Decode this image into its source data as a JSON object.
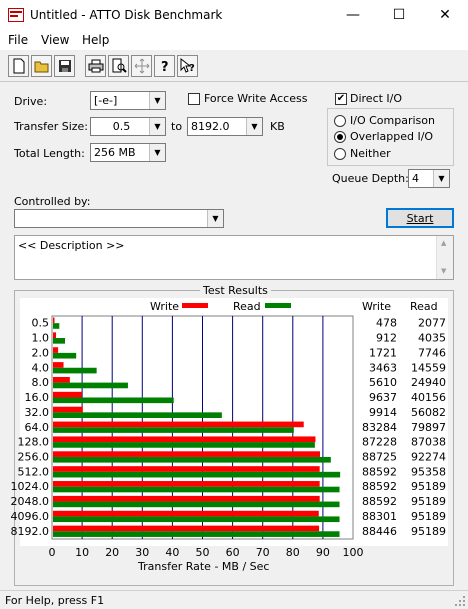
{
  "window": {
    "title": "Untitled - ATTO Disk Benchmark",
    "minimize_glyph": "—",
    "maximize_glyph": "☐",
    "close_glyph": "✕"
  },
  "menu": {
    "items": [
      "File",
      "View",
      "Help"
    ]
  },
  "toolbar": {
    "icons": [
      "new-document-icon",
      "open-folder-icon",
      "save-icon",
      "print-icon",
      "print-preview-icon",
      "move-icon",
      "help-icon",
      "context-help-icon"
    ]
  },
  "settings": {
    "drive_label": "Drive:",
    "drive_value": "[-e-]",
    "force_write_label": "Force Write Access",
    "force_write_checked": false,
    "direct_io_label": "Direct I/O",
    "direct_io_checked": true,
    "transfer_size_label": "Transfer Size:",
    "transfer_from": "0.5",
    "transfer_to_label": "to",
    "transfer_to": "8192.0",
    "transfer_unit": "KB",
    "total_length_label": "Total Length:",
    "total_length": "256 MB",
    "io_comparison_label": "I/O Comparison",
    "overlapped_io_label": "Overlapped I/O",
    "neither_label": "Neither",
    "selected_mode": "Overlapped I/O",
    "queue_depth_label": "Queue Depth:",
    "queue_depth": "4",
    "controlled_by_label": "Controlled by:",
    "controlled_by_value": "",
    "start_label": "Start",
    "description_text": "<< Description >>"
  },
  "results": {
    "title": "Test Results",
    "write_legend": "Write",
    "read_legend": "Read",
    "write_col": "Write",
    "read_col": "Read",
    "xlabel": "Transfer Rate - MB / Sec"
  },
  "chart_data": {
    "type": "bar",
    "title": "Test Results",
    "xlabel": "Transfer Rate - MB / Sec",
    "ylabel": "",
    "xlim": [
      0,
      100
    ],
    "xticks": [
      0,
      10,
      20,
      30,
      40,
      50,
      60,
      70,
      80,
      90,
      100
    ],
    "categories": [
      "0.5",
      "1.0",
      "2.0",
      "4.0",
      "8.0",
      "16.0",
      "32.0",
      "64.0",
      "128.0",
      "256.0",
      "512.0",
      "1024.0",
      "2048.0",
      "4096.0",
      "8192.0"
    ],
    "series": [
      {
        "name": "Write",
        "color": "#ff0000",
        "bar_values": [
          0.5,
          1,
          1.7,
          3.5,
          5.6,
          9.6,
          9.9,
          83.3,
          87.2,
          88.7,
          88.6,
          88.6,
          88.6,
          88.3,
          88.4
        ],
        "values": [
          478,
          912,
          1721,
          3463,
          5610,
          9637,
          9914,
          83284,
          87228,
          88725,
          88592,
          88592,
          88592,
          88301,
          88446
        ]
      },
      {
        "name": "Read",
        "color": "#008000",
        "bar_values": [
          2.1,
          4,
          7.7,
          14.5,
          24.9,
          40.1,
          56.1,
          80,
          87,
          92.3,
          95.4,
          95.2,
          95.2,
          95.2,
          95.2
        ],
        "values": [
          2077,
          4035,
          7746,
          14559,
          24940,
          40156,
          56082,
          79897,
          87038,
          92274,
          95358,
          95189,
          95189,
          95189,
          95189
        ]
      }
    ]
  },
  "status": {
    "text": "For Help, press F1"
  }
}
